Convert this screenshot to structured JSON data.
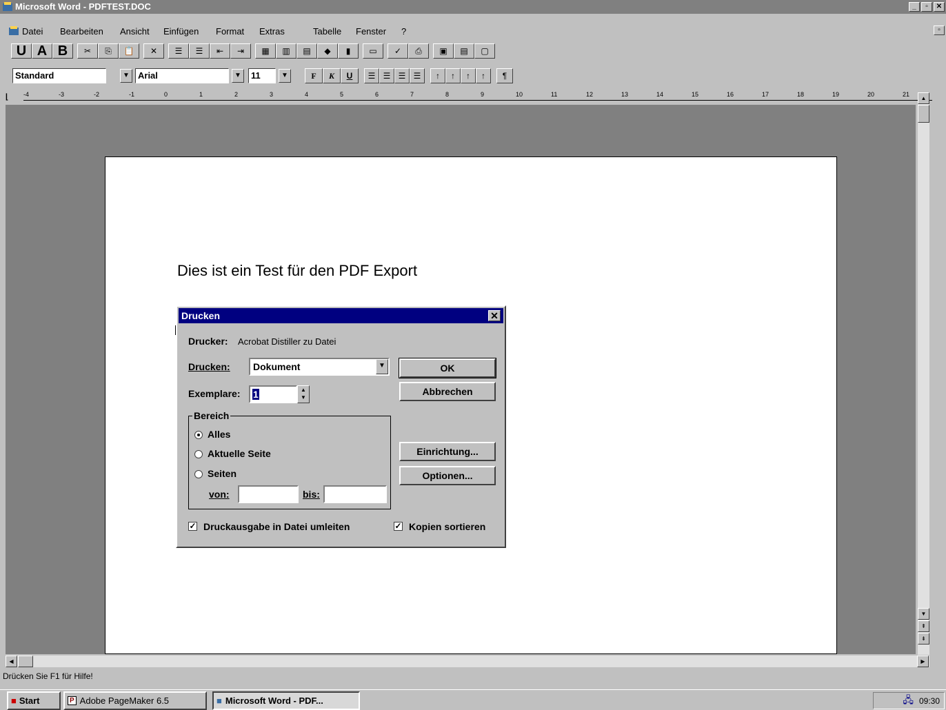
{
  "window": {
    "title": "Microsoft Word - PDFTEST.DOC"
  },
  "menu": [
    "Datei",
    "Bearbeiten",
    "Ansicht",
    "Einfügen",
    "Format",
    "Extras",
    "Tabelle",
    "Fenster",
    "?"
  ],
  "format_toolbar": {
    "style": "Standard",
    "font": "Arial",
    "size": "11",
    "bold": "F",
    "italic": "K",
    "underline": "U",
    "pilcrow": "¶"
  },
  "toolbar_letters": [
    "U",
    "A",
    "B"
  ],
  "ruler": [
    "-4",
    "-3",
    "-2",
    "-1",
    "0",
    "1",
    "2",
    "3",
    "4",
    "5",
    "6",
    "7",
    "8",
    "9",
    "10",
    "11",
    "12",
    "13",
    "14",
    "15",
    "16",
    "17",
    "18",
    "19",
    "20",
    "21"
  ],
  "document": {
    "text": "Dies ist ein Test für den PDF Export"
  },
  "dialog": {
    "title": "Drucken",
    "printer_label": "Drucker:",
    "printer_value": "Acrobat Distiller zu Datei",
    "print_label": "Drucken:",
    "print_value": "Dokument",
    "copies_label": "Exemplare:",
    "copies_value": "1",
    "range_label": "Bereich",
    "opt_all": "Alles",
    "opt_current": "Aktuelle Seite",
    "opt_pages": "Seiten",
    "from_label": "von:",
    "to_label": "bis:",
    "ok": "OK",
    "cancel": "Abbrechen",
    "setup": "Einrichtung...",
    "options": "Optionen...",
    "print_to_file": "Druckausgabe in Datei umleiten",
    "collate": "Kopien sortieren"
  },
  "status": {
    "text": "Drücken Sie F1 für Hilfe!"
  },
  "taskbar": {
    "start": "Start",
    "task1": "Adobe PageMaker 6.5",
    "task2": "Microsoft Word - PDF...",
    "time": "09:30"
  }
}
